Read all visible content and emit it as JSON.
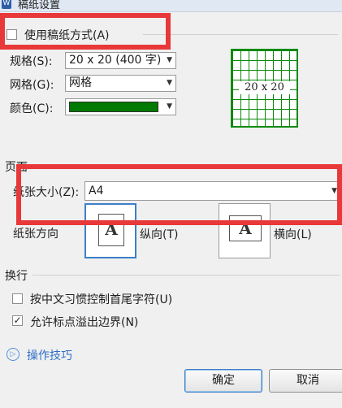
{
  "window": {
    "title": "稿纸设置",
    "app_icon": "W"
  },
  "manuscript": {
    "use_label": "使用稿纸方式(A)",
    "use_checked": "",
    "spec_label": "规格(S):",
    "spec_value": "20 x 20 (400 字)",
    "grid_label": "网格(G):",
    "grid_value": "网格",
    "color_label": "颜色(C):",
    "color_value": "#007a00",
    "preview_text": "20 x 20"
  },
  "page": {
    "section_label": "页面",
    "size_label": "纸张大小(Z):",
    "size_value": "A4",
    "orientation_label": "纸张方向",
    "orientation_glyph": "A",
    "portrait_label": "纵向(T)",
    "landscape_label": "横向(L)"
  },
  "wrap": {
    "section_label": "换行",
    "option1_label": "按中文习惯控制首尾字符(U)",
    "option1_checked": "",
    "option2_label": "允许标点溢出边界(N)",
    "option2_checked": "✓"
  },
  "tips": {
    "label": "操作技巧",
    "icon": "▷"
  },
  "buttons": {
    "ok": "确定",
    "cancel": "取消"
  },
  "colors": {
    "annotation_red": "#e8383a",
    "grid_green": "#0a8a0a",
    "link_blue": "#2f6fc9"
  }
}
